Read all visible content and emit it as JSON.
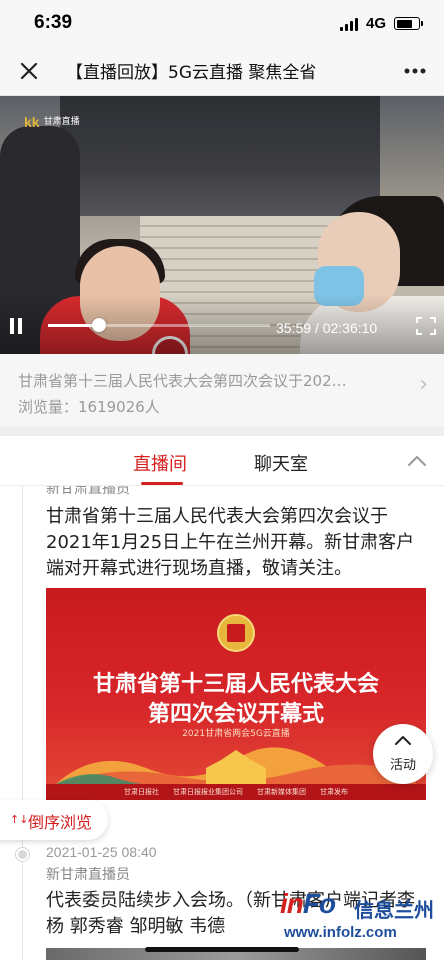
{
  "status": {
    "time": "6:39",
    "network": "4G",
    "battery_level": 0.75
  },
  "nav": {
    "title": "【直播回放】5G云直播 聚焦全省"
  },
  "video": {
    "logo_mark": "kk",
    "logo_text": "甘肃直播",
    "current_time": "35:59",
    "separator": "/",
    "duration": "02:36:10",
    "progress": 0.23
  },
  "info": {
    "title": "甘肃省第十三届人民代表大会第四次会议于202…",
    "views": "浏览量：1619026人"
  },
  "tabs": [
    {
      "label": "直播间",
      "active": true
    },
    {
      "label": "聊天室",
      "active": false
    }
  ],
  "feed": {
    "post1": {
      "author": "新甘肃直播员",
      "text": "甘肃省第十三届人民代表大会第四次会议于2021年1月25日上午在兰州开幕。新甘肃客户端对开幕式进行现场直播，敬请关注。"
    },
    "banner": {
      "line1": "甘肃省第十三届人民代表大会",
      "line2": "第四次会议开幕式",
      "subtitle": "2021甘肃省两会5G云直播",
      "footer": [
        "甘肃日报社",
        "甘肃日报报业集团公司",
        "甘肃新媒体集团",
        "甘肃发布"
      ]
    },
    "post2": {
      "time": "2021-01-25 08:40",
      "author": "新甘肃直播员",
      "text": "代表委员陆续步入会场。（新甘肃客户端记者李杨 郭秀睿 邹明敏 韦德"
    }
  },
  "activity_button": {
    "label": "活动"
  },
  "sort_button": {
    "icon": "↑↓",
    "label": "倒序浏览"
  },
  "watermark": {
    "brand_red": "in",
    "brand_blue": "Fo",
    "cn": "信息兰州",
    "url": "www.infolz.com"
  },
  "colors": {
    "accent": "#d6201f",
    "banner_red": "#c81b1d",
    "watermark_blue": "#1f4e9d"
  }
}
